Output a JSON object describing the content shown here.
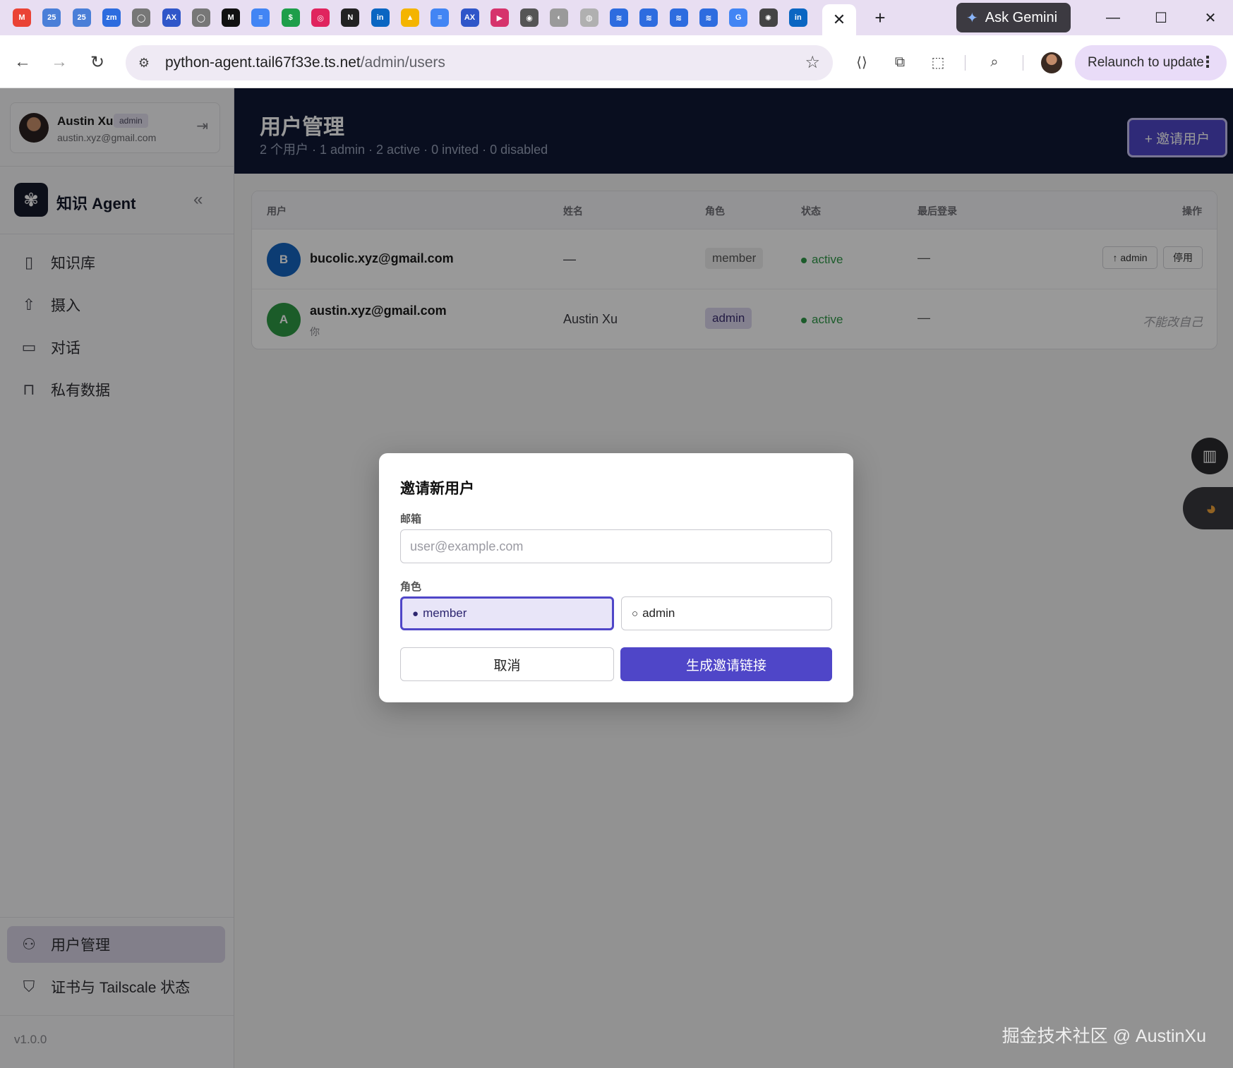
{
  "browser": {
    "tab_icons": [
      {
        "name": "gmail-icon",
        "glyph": "M",
        "color": "#ea4335"
      },
      {
        "name": "calendar-icon",
        "glyph": "25",
        "color": "#4a7fd8"
      },
      {
        "name": "calendar-icon",
        "glyph": "25",
        "color": "#4a7fd8"
      },
      {
        "name": "zoom-icon",
        "glyph": "zm",
        "color": "#2d6cdf"
      },
      {
        "name": "github-icon",
        "glyph": "◯",
        "color": "#777777"
      },
      {
        "name": "ax-icon",
        "glyph": "AX",
        "color": "#2f56c9"
      },
      {
        "name": "github-icon",
        "glyph": "◯",
        "color": "#777777"
      },
      {
        "name": "medium-icon",
        "glyph": "M",
        "color": "#111111"
      },
      {
        "name": "docs-icon",
        "glyph": "≡",
        "color": "#4285f4"
      },
      {
        "name": "dollar-icon",
        "glyph": "$",
        "color": "#1e9e4a"
      },
      {
        "name": "lifebuoy-icon",
        "glyph": "◎",
        "color": "#e0245e"
      },
      {
        "name": "notion-icon",
        "glyph": "N",
        "color": "#222222"
      },
      {
        "name": "linkedin-icon",
        "glyph": "in",
        "color": "#0a66c2"
      },
      {
        "name": "drive-icon",
        "glyph": "▲",
        "color": "#f4b400"
      },
      {
        "name": "docs-icon",
        "glyph": "≡",
        "color": "#4285f4"
      },
      {
        "name": "ax-icon",
        "glyph": "AX",
        "color": "#2f56c9"
      },
      {
        "name": "play-icon",
        "glyph": "▶",
        "color": "#d6336c"
      },
      {
        "name": "chrome-icon",
        "glyph": "◉",
        "color": "#555555"
      },
      {
        "name": "globe-icon",
        "glyph": "◐",
        "color": "#9a9a9a"
      },
      {
        "name": "fingerprint-icon",
        "glyph": "◍",
        "color": "#b0b0b0"
      },
      {
        "name": "layers-icon",
        "glyph": "≋",
        "color": "#2d6cdf"
      },
      {
        "name": "layers-icon",
        "glyph": "≋",
        "color": "#2d6cdf"
      },
      {
        "name": "layers-icon",
        "glyph": "≋",
        "color": "#2d6cdf"
      },
      {
        "name": "layers-icon",
        "glyph": "≋",
        "color": "#2d6cdf"
      },
      {
        "name": "google-icon",
        "glyph": "G",
        "color": "#4285f4"
      },
      {
        "name": "openai-icon",
        "glyph": "✺",
        "color": "#444444"
      },
      {
        "name": "linkedin-icon",
        "glyph": "in",
        "color": "#0a66c2"
      }
    ],
    "active_tab_close": "✕",
    "new_tab": "+",
    "gemini_label": "Ask Gemini",
    "url_host": "python-agent.tail67f33e.ts.net",
    "url_path": "/admin/users",
    "relaunch_label": "Relaunch to update"
  },
  "sidebar": {
    "user_name": "Austin Xu",
    "user_badge": "admin",
    "user_email": "austin.xyz@gmail.com",
    "brand": "知识 Agent",
    "nav": [
      {
        "label": "知识库",
        "icon": "book-icon"
      },
      {
        "label": "摄入",
        "icon": "upload-icon"
      },
      {
        "label": "对话",
        "icon": "chat-icon"
      },
      {
        "label": "私有数据",
        "icon": "lock-icon"
      }
    ],
    "admin_nav": [
      {
        "label": "用户管理",
        "icon": "users-icon"
      },
      {
        "label": "证书与 Tailscale 状态",
        "icon": "shield-icon"
      }
    ],
    "version": "v1.0.0"
  },
  "header": {
    "title": "用户管理",
    "subtitle": "2 个用户 · 1 admin · 2 active · 0 invited · 0 disabled",
    "invite_button": "+ 邀请用户"
  },
  "table": {
    "columns": [
      "用户",
      "姓名",
      "角色",
      "状态",
      "最后登录",
      "操作"
    ],
    "rows": [
      {
        "initial": "B",
        "avatar_color": "#1565c0",
        "email": "bucolic.xyz@gmail.com",
        "note": "",
        "name": "—",
        "role": "member",
        "status": "active",
        "last_login": "—",
        "actions": [
          "↑ admin",
          "停用"
        ],
        "action_note": ""
      },
      {
        "initial": "A",
        "avatar_color": "#2e9a45",
        "email": "austin.xyz@gmail.com",
        "note": "你",
        "name": "Austin Xu",
        "role": "admin",
        "status": "active",
        "last_login": "—",
        "actions": [],
        "action_note": "不能改自己"
      }
    ]
  },
  "modal": {
    "title": "邀请新用户",
    "email_label": "邮箱",
    "email_value": "",
    "email_placeholder": "user@example.com",
    "role_label": "角色",
    "role_options": [
      {
        "label": "member",
        "selected": true,
        "mark": "●"
      },
      {
        "label": "admin",
        "selected": false,
        "mark": "○"
      }
    ],
    "cancel": "取消",
    "submit": "生成邀请链接"
  },
  "watermark": "掘金技术社区 @ AustinXu",
  "colors": {
    "accent": "#4f46c8",
    "header_bg": "#0f1834",
    "status_active": "#2f9a48"
  }
}
